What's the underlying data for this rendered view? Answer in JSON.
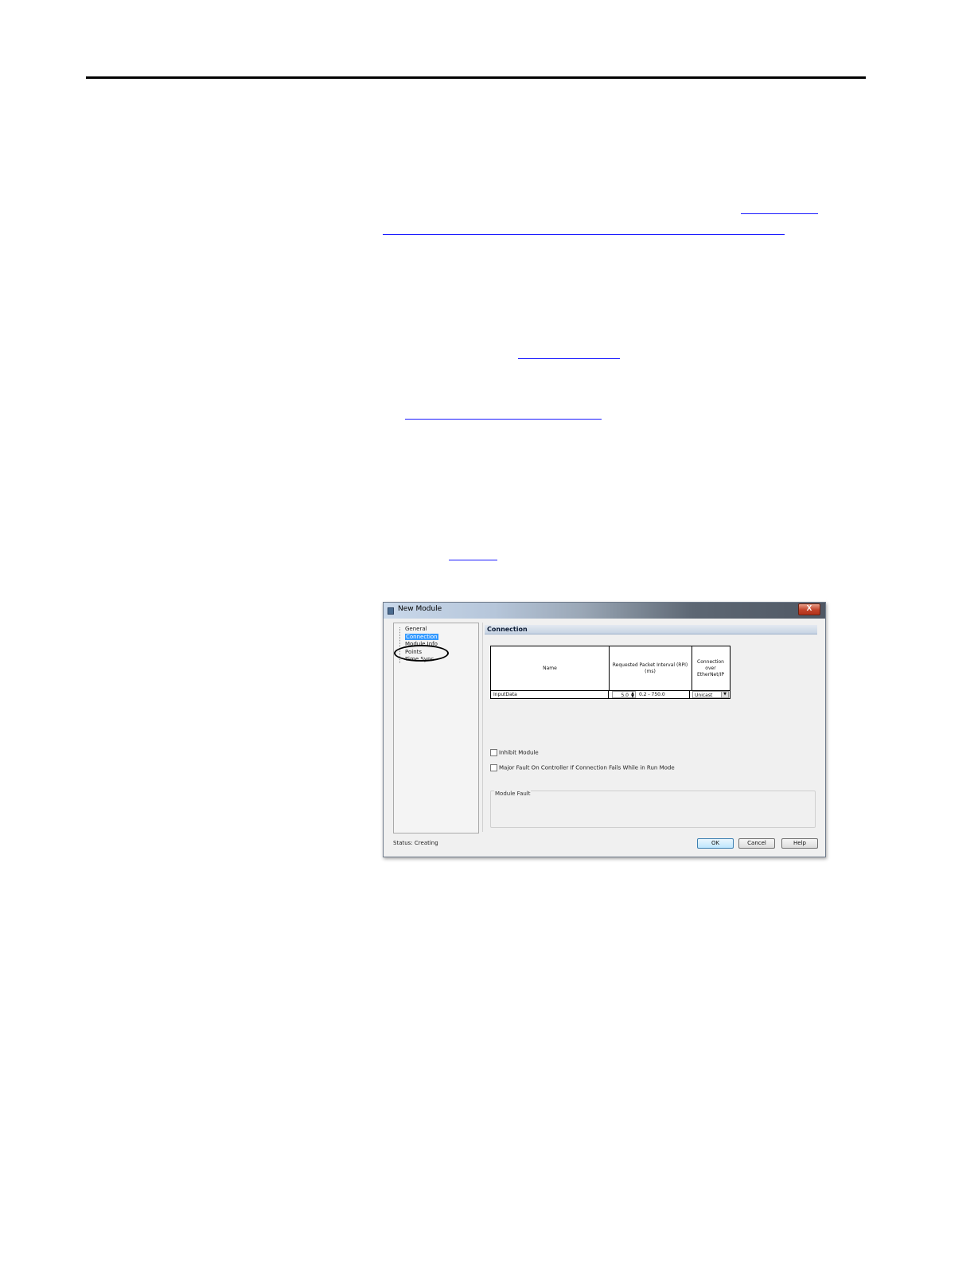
{
  "dialog": {
    "title": "New Module",
    "close_glyph": "X",
    "tree": {
      "items": [
        {
          "label": "General"
        },
        {
          "label": "Connection"
        },
        {
          "label": "Module Info"
        },
        {
          "label": "Points"
        },
        {
          "label": "Time Sync"
        }
      ],
      "selected": "Connection"
    },
    "section_title": "Connection",
    "table": {
      "headers": {
        "name": "Name",
        "rpi": "Requested Packet Interval (RPI) (ms)",
        "connection": "Connection over EtherNet/IP"
      },
      "row": {
        "name": "InputData",
        "rpi_value": "5.0",
        "rpi_range": "0.2 - 750.0",
        "connection": "Unicast"
      }
    },
    "checkboxes": {
      "inhibit_module": "Inhibit Module",
      "major_fault": "Major Fault On Controller If Connection Fails While in Run Mode"
    },
    "module_fault_label": "Module Fault",
    "status_label": "Status:",
    "status_value": "Creating",
    "buttons": {
      "ok": "OK",
      "cancel": "Cancel",
      "help": "Help"
    }
  },
  "colors": {
    "selected_item": "#3399ff",
    "link_underline": "#1a1aff",
    "close_button": "#c3432a"
  }
}
